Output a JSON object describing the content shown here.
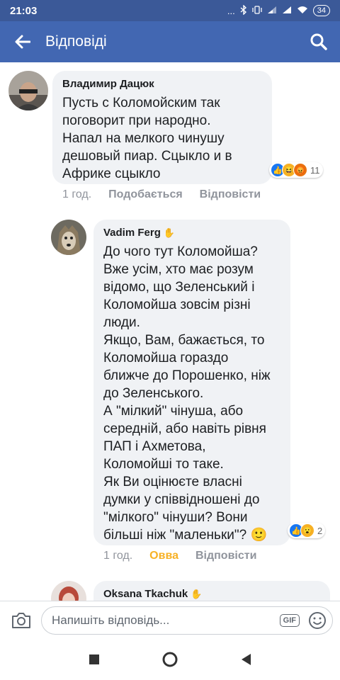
{
  "status_bar": {
    "time": "21:03",
    "battery": "34",
    "icons_text": "..."
  },
  "app_bar": {
    "title": "Відповіді"
  },
  "comments": [
    {
      "author": "Владимир Дацюк",
      "text": "Пусть с Коломойским так\nпоговорит при народно.\nНапал на мелкого чинушу\nдешовый пиар. Сцыкло и в\nАфрике сцыкло",
      "reactions": [
        "like",
        "haha",
        "angry"
      ],
      "reaction_count": "11",
      "time": "1 год.",
      "like_label": "Подобається",
      "reply_label": "Відповісти"
    },
    {
      "author": "Vadim Ferg",
      "text": "До чого тут Коломойша?\nВже усім, хто має розум\nвідомо, що Зеленський і\nКоломойша зовсім різні\nлюди.\nЯкщо, Вам, бажається, то\nКоломойша гораздо\nближче до Порошенко, ніж\nдо Зеленського.\nА \"мілкий\" чінуша, або\nсередній, або навіть рівня\nПАП і Ахметова,\nКоломойші то таке.\nЯк Ви оцінюєте власні\nдумки у співвідношені до\n\"мілкого\" чінуши? Вони\nбільші ніж \"маленьки\"? 🙂",
      "reactions": [
        "like",
        "wow"
      ],
      "reaction_count": "2",
      "time": "1 год.",
      "like_label": "Овва",
      "reply_label": "Відповісти"
    },
    {
      "author": "Oksana Tkachuk"
    }
  ],
  "composer": {
    "placeholder": "Напишіть відповідь...",
    "gif_label": "GIF"
  },
  "colors": {
    "header": "#4267b2",
    "status": "#3b5998",
    "bubble": "#f0f2f5",
    "reacted": "#f7b125"
  }
}
